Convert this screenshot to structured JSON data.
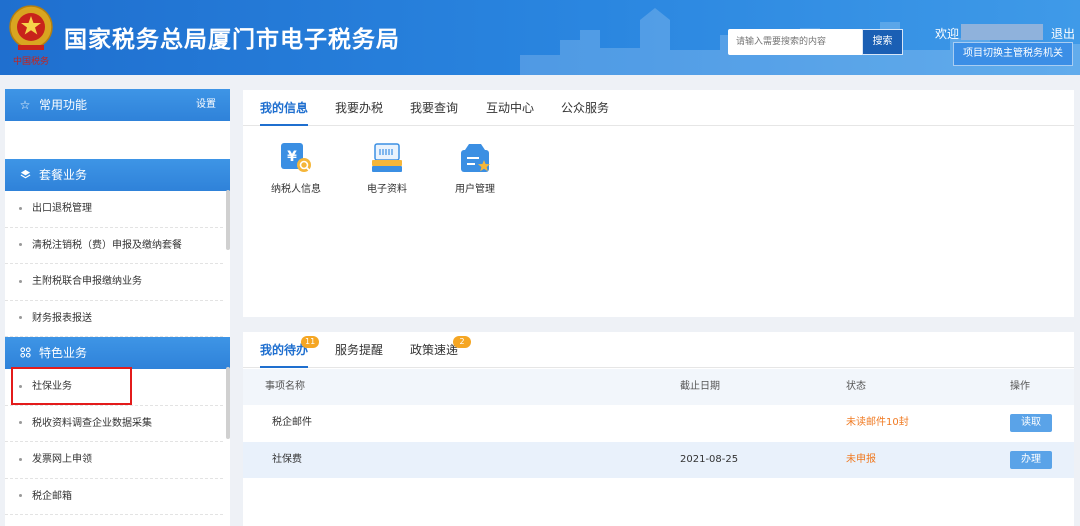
{
  "header": {
    "title": "国家税务总局厦门市电子税务局",
    "emblem_text": "中国税务",
    "search_placeholder": "请输入需要搜索的内容",
    "search_button": "搜索",
    "welcome": "欢迎",
    "logout": "退出",
    "switch_button": "项目切换主管税务机关"
  },
  "sidebar": {
    "common": {
      "label": "常用功能",
      "setting": "设置",
      "icon": "star-icon"
    },
    "package": {
      "label": "套餐业务",
      "icon": "layers-icon",
      "items": [
        "出口退税管理",
        "清税注销税（费）申报及缴纳套餐",
        "主附税联合申报缴纳业务",
        "财务报表报送"
      ]
    },
    "special": {
      "label": "特色业务",
      "icon": "grid-icon",
      "items": [
        "社保业务",
        "税收资料调查企业数据采集",
        "发票网上申领",
        "税企邮箱"
      ]
    }
  },
  "info_panel": {
    "tabs": [
      "我的信息",
      "我要办税",
      "我要查询",
      "互动中心",
      "公众服务"
    ],
    "tiles": [
      {
        "label": "纳税人信息",
        "icon": "taxpayer-info-icon"
      },
      {
        "label": "电子资料",
        "icon": "electronic-docs-icon"
      },
      {
        "label": "用户管理",
        "icon": "user-management-icon"
      }
    ]
  },
  "todo_panel": {
    "tabs": [
      {
        "label": "我的待办",
        "badge": "11"
      },
      {
        "label": "服务提醒",
        "badge": ""
      },
      {
        "label": "政策速递",
        "badge": "2"
      }
    ],
    "columns": [
      "事项名称",
      "截止日期",
      "状态",
      "操作"
    ],
    "rows": [
      {
        "name": "税企邮件",
        "deadline": "",
        "status": "未读邮件10封",
        "action": "读取"
      },
      {
        "name": "社保费",
        "deadline": "2021-08-25",
        "status": "未申报",
        "action": "办理"
      }
    ]
  },
  "colors": {
    "brand_blue": "#1f6fcf",
    "warning_orange": "#f07a22",
    "badge_orange": "#f5a623",
    "highlight_red": "#e31b1b"
  }
}
